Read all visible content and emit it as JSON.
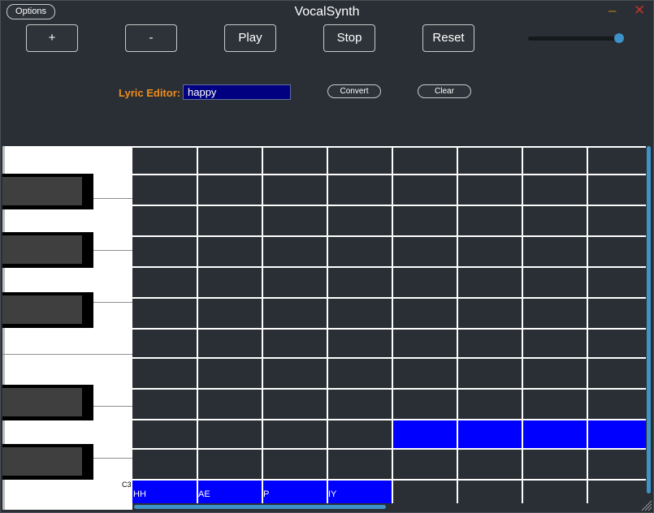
{
  "window": {
    "title": "VocalSynth",
    "options_label": "Options",
    "minimize_glyph": "–",
    "close_glyph": "✕"
  },
  "toolbar": {
    "add_label": "+",
    "remove_label": "-",
    "play_label": "Play",
    "stop_label": "Stop",
    "reset_label": "Reset"
  },
  "volume": {
    "value": 0.95
  },
  "lyric_editor": {
    "label": "Lyric Editor:",
    "value": "happy",
    "convert_label": "Convert",
    "clear_label": "Clear"
  },
  "piano": {
    "octave_label": "C3"
  },
  "notes": [
    {
      "phoneme": "HH"
    },
    {
      "phoneme": "AE"
    },
    {
      "phoneme": "P"
    },
    {
      "phoneme": "IY"
    }
  ],
  "colors": {
    "accent": "#3d92c7",
    "note": "#0000ff",
    "label": "#f08c1a",
    "background": "#2a2f35"
  }
}
